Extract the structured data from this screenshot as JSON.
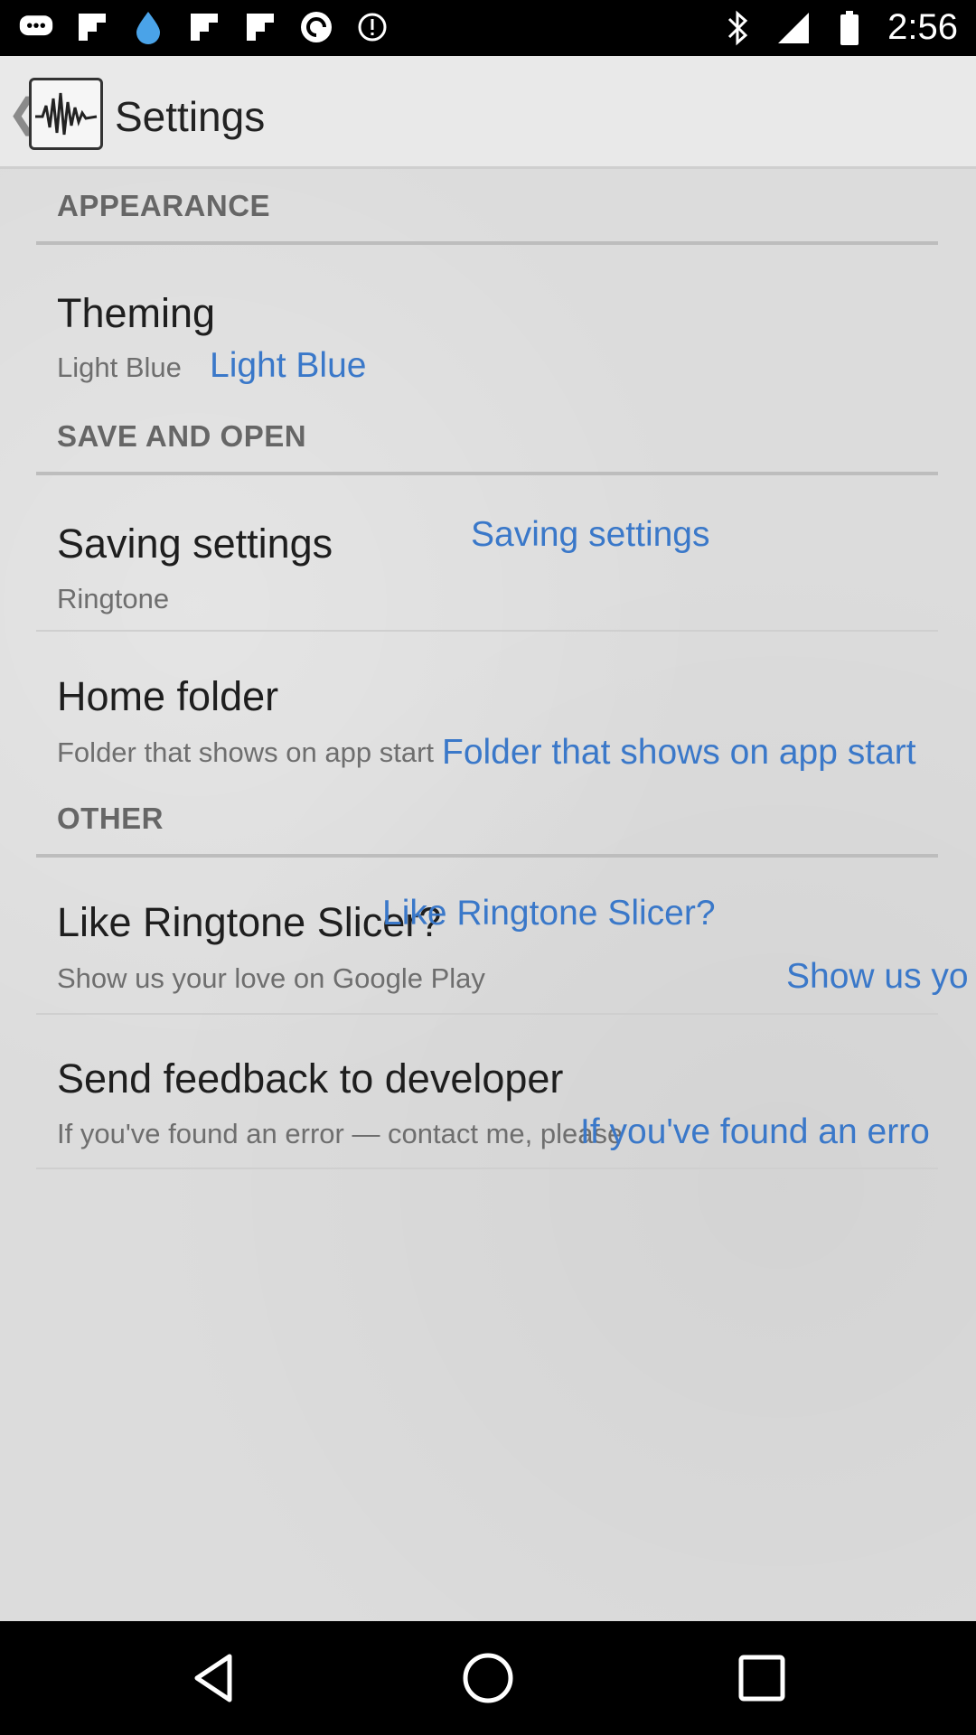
{
  "status_bar": {
    "time": "2:56",
    "left_icons": [
      "chat-icon",
      "flipboard-icon",
      "water-drop-icon",
      "flipboard-icon",
      "flipboard-icon",
      "pocket-casts-icon",
      "alert-icon"
    ],
    "right_icons": [
      "bluetooth-icon",
      "signal-icon",
      "battery-icon"
    ]
  },
  "app_bar": {
    "title": "Settings"
  },
  "sections": {
    "appearance": "APPEARANCE",
    "save_and_open": "SAVE AND OPEN",
    "other": "OTHER"
  },
  "prefs": {
    "theming": {
      "title": "Theming",
      "summary": "Light Blue",
      "overlay": "Light Blue"
    },
    "saving_settings": {
      "title": "Saving settings",
      "summary": "Ringtone",
      "overlay": "Saving settings"
    },
    "home_folder": {
      "title": "Home folder",
      "summary": "Folder that shows on app start",
      "overlay": "Folder that shows on app start"
    },
    "like": {
      "title": "Like Ringtone Slicer?",
      "summary": "Show us your love on Google Play",
      "overlay_title": "Like Ringtone Slicer?",
      "overlay_summary": "Show us yo"
    },
    "feedback": {
      "title": "Send feedback to developer",
      "summary": "If you've found an error — contact me, please",
      "overlay": "If you've found an erro"
    }
  },
  "colors": {
    "accent": "#3a78c9",
    "background": "#dcdcdc"
  }
}
